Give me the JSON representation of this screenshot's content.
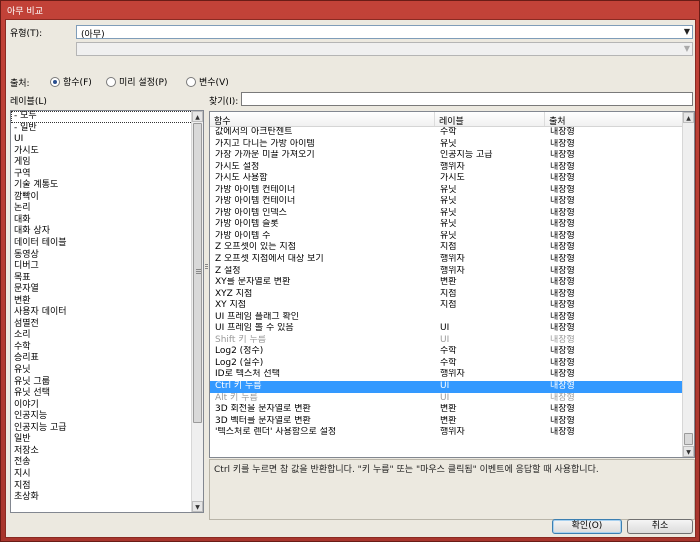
{
  "window": {
    "title": "아무 비교"
  },
  "type_label": "유형(T):",
  "type_value": "(아무)",
  "source_label": "출처:",
  "sources": [
    {
      "label": "함수(F)",
      "selected": true
    },
    {
      "label": "미리 설정(P)",
      "selected": false
    },
    {
      "label": "변수(V)",
      "selected": false
    }
  ],
  "label_label": "레이블(L)",
  "search_label": "찾기(I):",
  "search_value": "",
  "labels": [
    "- 모두",
    "- 일반",
    "UI",
    "가시도",
    "게임",
    "구역",
    "기술 계통도",
    "깜빡이",
    "논리",
    "대화",
    "대화 상자",
    "데이터 테이블",
    "동영상",
    "디버그",
    "목표",
    "문자열",
    "변환",
    "사용자 데이터",
    "섬멸전",
    "소리",
    "수학",
    "승리표",
    "유닛",
    "유닛 그룹",
    "유닛 선택",
    "이야기",
    "인공지능",
    "인공지능 고급",
    "일반",
    "저장소",
    "전송",
    "지시",
    "지점",
    "초상화"
  ],
  "columns": [
    "함수",
    "레이블",
    "출처"
  ],
  "rows": [
    {
      "name": "값에서의 아크탄젠트",
      "label": "수학",
      "source": "내장형",
      "style": ""
    },
    {
      "name": "가지고 다니는 가방 아이템",
      "label": "유닛",
      "source": "내장형",
      "style": ""
    },
    {
      "name": "가장 가까운 미끌 가져오기",
      "label": "인공지능 고급",
      "source": "내장형",
      "style": ""
    },
    {
      "name": "가시도 설정",
      "label": "행위자",
      "source": "내장형",
      "style": ""
    },
    {
      "name": "가시도 사용함",
      "label": "가시도",
      "source": "내장형",
      "style": ""
    },
    {
      "name": "가방 아이템 컨테이너",
      "label": "유닛",
      "source": "내장형",
      "style": ""
    },
    {
      "name": "가방 아이템 컨테이너",
      "label": "유닛",
      "source": "내장형",
      "style": ""
    },
    {
      "name": "가방 아이템 인덱스",
      "label": "유닛",
      "source": "내장형",
      "style": ""
    },
    {
      "name": "가방 아이템 슬롯",
      "label": "유닛",
      "source": "내장형",
      "style": ""
    },
    {
      "name": "가방 아이템 수",
      "label": "유닛",
      "source": "내장형",
      "style": ""
    },
    {
      "name": "Z 오프셋이 있는 지점",
      "label": "지점",
      "source": "내장형",
      "style": ""
    },
    {
      "name": "Z 오프셋 지점에서 대상 보기",
      "label": "행위자",
      "source": "내장형",
      "style": ""
    },
    {
      "name": "Z 설정",
      "label": "행위자",
      "source": "내장형",
      "style": ""
    },
    {
      "name": "XY를 문자열로 변환",
      "label": "변환",
      "source": "내장형",
      "style": ""
    },
    {
      "name": "XYZ 지점",
      "label": "지점",
      "source": "내장형",
      "style": ""
    },
    {
      "name": "XY 지점",
      "label": "지점",
      "source": "내장형",
      "style": ""
    },
    {
      "name": "UI 프레임 플래그 확인",
      "label": "",
      "source": "내장형",
      "style": ""
    },
    {
      "name": "UI 프레임 볼 수 있음",
      "label": "UI",
      "source": "내장형",
      "style": ""
    },
    {
      "name": "Shift 키 누름",
      "label": "UI",
      "source": "내장형",
      "style": "gray"
    },
    {
      "name": "Log2 (정수)",
      "label": "수학",
      "source": "내장형",
      "style": ""
    },
    {
      "name": "Log2 (실수)",
      "label": "수학",
      "source": "내장형",
      "style": ""
    },
    {
      "name": "ID로 텍스처 선택",
      "label": "행위자",
      "source": "내장형",
      "style": ""
    },
    {
      "name": "Ctrl 키 누름",
      "label": "UI",
      "source": "내장형",
      "style": "sel"
    },
    {
      "name": "Alt 키 누름",
      "label": "UI",
      "source": "내장형",
      "style": "gray"
    },
    {
      "name": "3D 회전을 문자열로 변환",
      "label": "변환",
      "source": "내장형",
      "style": ""
    },
    {
      "name": "3D 벡터를 문자열로 변환",
      "label": "변환",
      "source": "내장형",
      "style": ""
    },
    {
      "name": "'텍스처로 렌더' 사용함으로 설정",
      "label": "행위자",
      "source": "내장형",
      "style": ""
    }
  ],
  "description": "Ctrl 키를 누르면 참 값을 반환합니다. \"키 누름\" 또는 \"마우스 클릭됨\" 이벤트에 응답할 때 사용합니다.",
  "buttons": {
    "ok": "확인(O)",
    "cancel": "취소"
  },
  "colors": {
    "titlebar": "#c24238",
    "selection": "#3399ff",
    "face": "#ece9e0"
  }
}
